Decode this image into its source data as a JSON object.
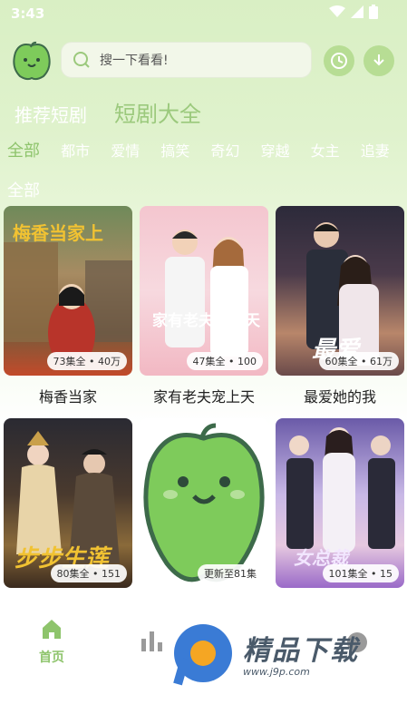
{
  "status": {
    "time": "3:43"
  },
  "search": {
    "placeholder": "搜一下看看!"
  },
  "main_tabs": [
    {
      "label": "推荐短剧",
      "active": false
    },
    {
      "label": "短剧大全",
      "active": true
    }
  ],
  "categories": [
    {
      "label": "全部",
      "active": true
    },
    {
      "label": "都市"
    },
    {
      "label": "爱情"
    },
    {
      "label": "搞笑"
    },
    {
      "label": "奇幻"
    },
    {
      "label": "穿越"
    },
    {
      "label": "女主"
    },
    {
      "label": "追妻"
    }
  ],
  "section_label": "全部",
  "dramas": [
    {
      "title": "梅香当家",
      "badge": "73集全 • 40万",
      "poster_caption": "梅香当家上"
    },
    {
      "title": "家有老夫宠上天",
      "badge": "47集全 • 100",
      "poster_caption": "家有老夫宠上天"
    },
    {
      "title": "最爱她的我",
      "badge": "60集全 • 61万",
      "poster_caption": "最爱"
    },
    {
      "title": "",
      "badge": "80集全 • 151",
      "poster_caption": "步步生莲"
    },
    {
      "title": "",
      "badge": "更新至81集",
      "poster_caption": ""
    },
    {
      "title": "",
      "badge": "101集全 • 15",
      "poster_caption": "女总裁"
    }
  ],
  "nav": {
    "home_label": "首页"
  },
  "watermark": {
    "brand": "精品下载",
    "url": "www.j9p.com"
  },
  "colors": {
    "accent": "#8ec46c",
    "light_green": "#d9efc4"
  }
}
